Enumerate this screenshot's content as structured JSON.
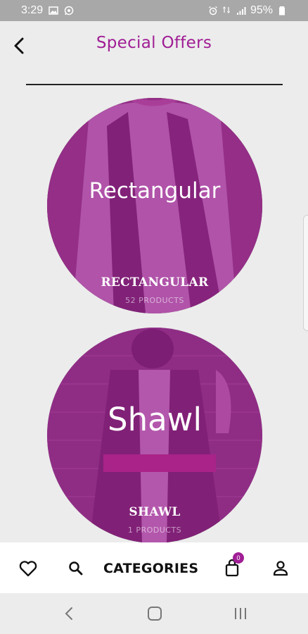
{
  "status_bar": {
    "time": "3:29",
    "battery": "95%",
    "icons_left": [
      "image-icon",
      "whatsapp-icon"
    ],
    "icons_right": [
      "alarm-icon",
      "data-4g-icon",
      "signal-icon",
      "battery-icon"
    ]
  },
  "header": {
    "title": "Special Offers",
    "back_icon": "chevron-left-icon"
  },
  "colors": {
    "brand": "#a01e95",
    "background": "#ececec",
    "status_bar": "#a8a8a8"
  },
  "categories": [
    {
      "overlay_label": "Rectangular",
      "name": "RECTANGULAR",
      "count": "52 PRODUCTS"
    },
    {
      "overlay_label": "Shawl",
      "name": "SHAWL",
      "count": "1 PRODUCTS"
    }
  ],
  "bottom_nav": {
    "favorites_icon": "heart-icon",
    "search_icon": "search-icon",
    "categories_label": "CATEGORIES",
    "cart_icon": "shopping-bag-icon",
    "cart_badge": "0",
    "account_icon": "user-icon"
  },
  "system_nav": {
    "buttons": [
      "back",
      "home",
      "recents"
    ]
  }
}
